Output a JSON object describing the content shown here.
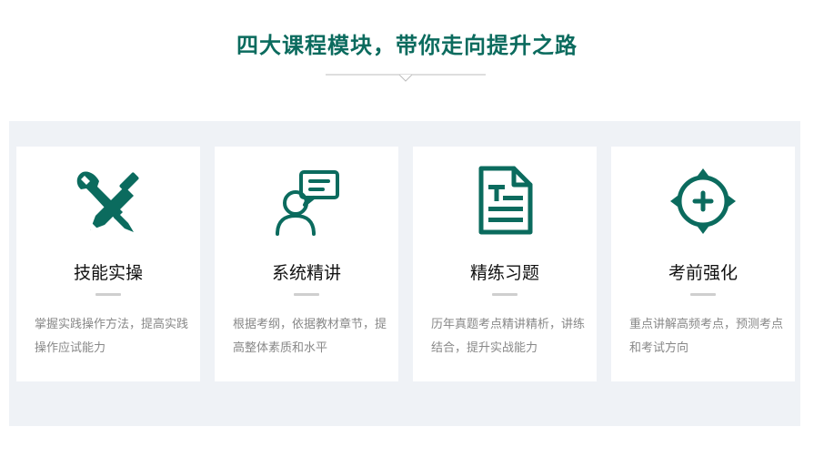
{
  "header": {
    "title": "四大课程模块，带你走向提升之路"
  },
  "theme": {
    "accent": "#0b6b5e",
    "band_bg": "#eff2f6"
  },
  "modules": [
    {
      "icon": "tools-icon",
      "title": "技能实操",
      "desc": "掌握实践操作方法，提高实践操作应试能力"
    },
    {
      "icon": "lecturer-chat-icon",
      "title": "系统精讲",
      "desc": "根据考纲，依据教材章节，提高整体素质和水平"
    },
    {
      "icon": "document-icon",
      "title": "精练习题",
      "desc": "历年真题考点精讲精析，讲练结合，提升实战能力"
    },
    {
      "icon": "target-plus-icon",
      "title": "考前强化",
      "desc": "重点讲解高频考点，预测考点和考试方向"
    }
  ]
}
